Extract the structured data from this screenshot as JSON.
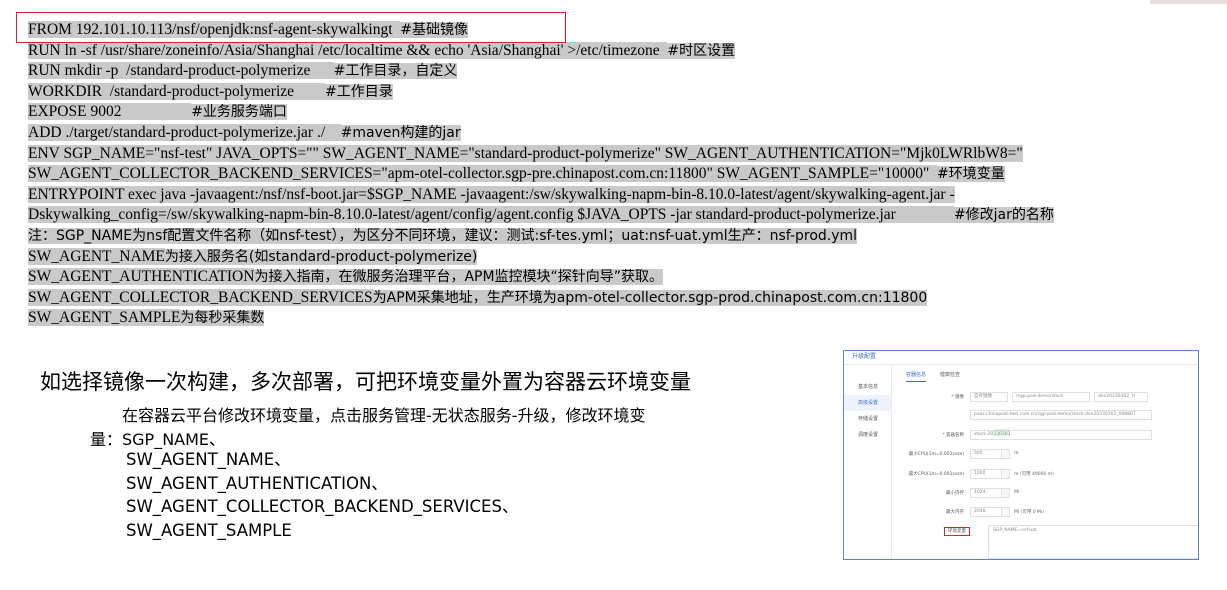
{
  "code_lines": [
    {
      "code": "FROM 192.101.10.113/nsf/openjdk:nsf-agent-skywalkingt  ",
      "comment": "#基础镜像"
    },
    {
      "code": "RUN ln -sf /usr/share/zoneinfo/Asia/Shanghai /etc/localtime && echo 'Asia/Shanghai' >/etc/timezone  ",
      "comment": "#时区设置"
    },
    {
      "code": "RUN mkdir -p  /standard-product-polymerize      ",
      "comment": "#工作目录，自定义"
    },
    {
      "code": "WORKDIR  /standard-product-polymerize        ",
      "comment": "#工作目录"
    },
    {
      "code": "EXPOSE 9002                  ",
      "comment": "#业务服务端口"
    },
    {
      "code": "ADD ./target/standard-product-polymerize.jar ./    ",
      "comment": "#maven构建的jar"
    },
    {
      "code": "ENV SGP_NAME=\"nsf-test\" JAVA_OPTS=\"\" SW_AGENT_NAME=\"standard-product-polymerize\" SW_AGENT_AUTHENTICATION=\"Mjk0LWRlbW8=\"",
      "comment": ""
    },
    {
      "code": "SW_AGENT_COLLECTOR_BACKEND_SERVICES=\"apm-otel-collector.sgp-pre.chinapost.com.cn:11800\" SW_AGENT_SAMPLE=\"10000\"  ",
      "comment": "#环境变量"
    },
    {
      "code": "ENTRYPOINT exec java -javaagent:/nsf/nsf-boot.jar=$SGP_NAME -javaagent:/sw/skywalking-napm-bin-8.10.0-latest/agent/skywalking-agent.jar -",
      "comment": ""
    },
    {
      "code": "Dskywalking_config=/sw/skywalking-napm-bin-8.10.0-latest/agent/config/agent.config $JAVA_OPTS -jar standard-product-polymerize.jar               ",
      "comment": "#修改jar的名称"
    },
    {
      "code": "",
      "comment": "注：SGP_NAME为nsf配置文件名称（如nsf-test），为区分不同环境，建议：测试:sf-tes.yml；uat:nsf-uat.yml生产：nsf-prod.yml"
    },
    {
      "code": "SW_AGENT_NAME",
      "comment": "为接入服务名(如standard-product-polymerize)"
    },
    {
      "code": "SW_AGENT_AUTHENTICATION",
      "comment": "为接入指南，在微服务治理平台，APM监控模块“探针向导”获取。"
    },
    {
      "code": "SW_AGENT_COLLECTOR_BACKEND_SERVICES",
      "comment": "为APM采集地址，生产环境为apm-otel-collector.sgp-prod.chinapost.com.cn:11800"
    },
    {
      "code": "SW_AGENT_SAMPLE",
      "comment": "为每秒采集数"
    }
  ],
  "explain": {
    "title": "如选择镜像一次构建，多次部署，可把环境变量外置为容器云环境变量",
    "sub1": "在容器云平台修改环境变量，点击服务管理-无状态服务-升级，修改环境变",
    "sub2": "量：SGP_NAME、",
    "vars": [
      "SW_AGENT_NAME、",
      "SW_AGENT_AUTHENTICATION、",
      "SW_AGENT_COLLECTOR_BACKEND_SERVICES、",
      "SW_AGENT_SAMPLE"
    ]
  },
  "panel": {
    "header": "升级配置",
    "side": [
      "基本信息",
      "高级设置",
      "存储设置",
      "调度设置"
    ],
    "tabs": [
      "容器信息",
      "健康检查"
    ],
    "image_label": "* 镜像",
    "image_source": "自有镜像",
    "image_name": "/sgp-pod-demo/stock",
    "image_tag": "dev20230302_H",
    "image_path": "paas.chinapost-test.com.cn/sgp-pod-demo/stock:dev20230302_098807",
    "container_label": "* 容器名称",
    "container_value": "stock-20230303",
    "rows": [
      {
        "label": "最小CPU(1m=0.001core)",
        "value": "500",
        "unit": "m"
      },
      {
        "label": "最大CPU(1m=0.001core)",
        "value": "1000",
        "unit": "m (可用 49000 m)"
      },
      {
        "label": "最小内存",
        "value": "1024",
        "unit": "Mi"
      },
      {
        "label": "最大内存",
        "value": "2048",
        "unit": "Mi (可用 0 Mi)"
      }
    ],
    "env_label": "环境变量",
    "env_value": "SGP_NAME=nsf-uat"
  }
}
